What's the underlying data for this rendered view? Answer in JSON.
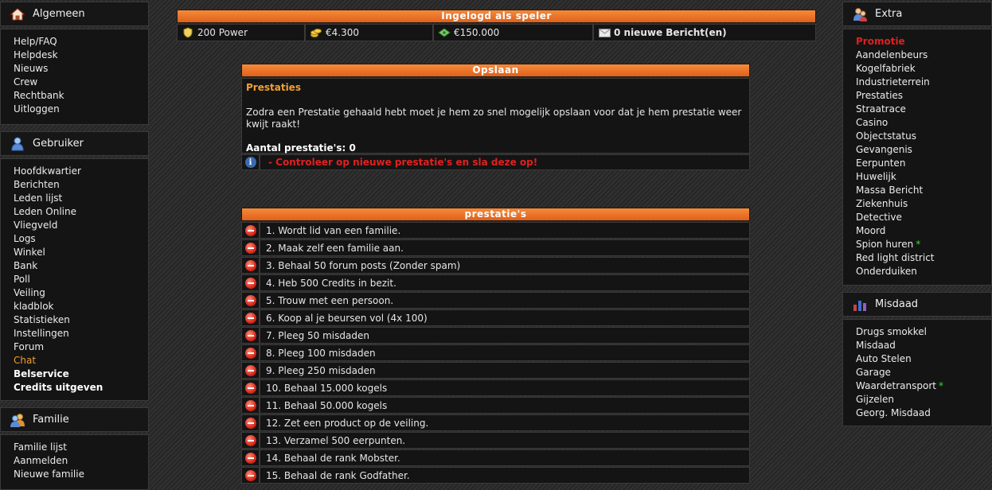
{
  "left": {
    "algemeen": {
      "title": "Algemeen",
      "icon": "house-icon",
      "items": [
        "Help/FAQ",
        "Helpdesk",
        "Nieuws",
        "Crew",
        "Rechtbank",
        "Uitloggen"
      ]
    },
    "gebruiker": {
      "title": "Gebruiker",
      "icon": "user-icon",
      "items": [
        "Hoofdkwartier",
        "Berichten",
        "Leden lijst",
        "Leden Online",
        "Vliegveld",
        "Logs",
        "Winkel",
        "Bank",
        "Poll",
        "Veiling",
        "kladblok",
        "Statistieken",
        "Instellingen",
        "Forum",
        "Chat",
        "Belservice",
        "Credits uitgeven"
      ]
    },
    "familie": {
      "title": "Familie",
      "icon": "group-icon",
      "items": [
        "Familie lijst",
        "Aanmelden",
        "Nieuwe familie"
      ]
    }
  },
  "header": {
    "title": "Ingelogd als speler",
    "power": "200 Power",
    "cash": "€4.300",
    "bank": "€150.000",
    "messages": "0 nieuwe Bericht(en)"
  },
  "opslaan": {
    "title": "Opslaan",
    "heading": "Prestaties",
    "text": "Zodra een Prestatie gehaald hebt moet je hem zo snel mogelijk opslaan voor dat je hem prestatie weer kwijt raakt!",
    "count": "Aantal prestatie's: 0",
    "warning": "- Controleer op nieuwe prestatie's en sla deze op!"
  },
  "prestaties": {
    "title": "prestatie's",
    "items": [
      "1. Wordt lid van een familie.",
      "2. Maak zelf een familie aan.",
      "3. Behaal 50 forum posts (Zonder spam)",
      "4. Heb 500 Credits in bezit.",
      "5. Trouw met een persoon.",
      "6. Koop al je beursen vol (4x 100)",
      "7. Pleeg 50 misdaden",
      "8. Pleeg 100 misdaden",
      "9. Pleeg 250 misdaden",
      "10. Behaal 15.000 kogels",
      "11. Behaal 50.000 kogels",
      "12. Zet een product op de veiling.",
      "13. Verzamel 500 eerpunten.",
      "14. Behaal de rank Mobster.",
      "15. Behaal de rank Godfather."
    ]
  },
  "right": {
    "extra": {
      "title": "Extra",
      "icon": "user-group-icon",
      "items": [
        "Promotie",
        "Aandelenbeurs",
        "Kogelfabriek",
        "Industrieterrein",
        "Prestaties",
        "Straatrace",
        "Casino",
        "Objectstatus",
        "Gevangenis",
        "Eerpunten",
        "Huwelijk",
        "Massa Bericht",
        "Ziekenhuis",
        "Detective",
        "Moord",
        "Spion huren",
        "Red light district",
        "Onderduiken"
      ]
    },
    "misdaad": {
      "title": "Misdaad",
      "icon": "bar-chart-icon",
      "items": [
        "Drugs smokkel",
        "Misdaad",
        "Auto Stelen",
        "Garage",
        "Waardetransport",
        "Gijzelen",
        "Georg. Misdaad"
      ]
    },
    "star": "*"
  }
}
